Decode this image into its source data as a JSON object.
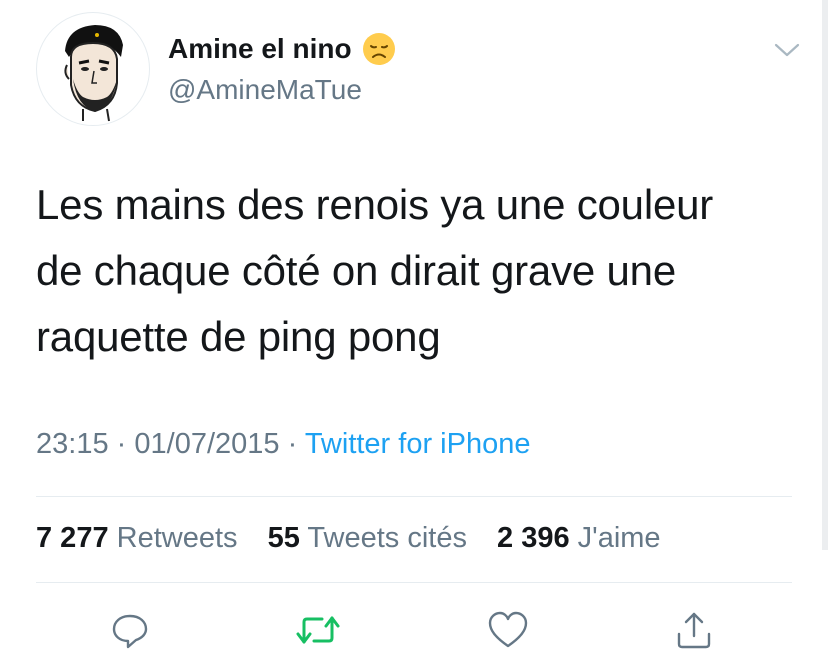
{
  "author": {
    "display_name": "Amine el nino",
    "handle": "@AmineMaTue",
    "emoji": "disappointed-face-emoji"
  },
  "tweet": {
    "lines": [
      "Les mains des renois ya une couleur",
      "de chaque côté on dirait grave une",
      "raquette de ping pong"
    ]
  },
  "meta": {
    "time": "23:15",
    "separator": "·",
    "date": "01/07/2015",
    "source": "Twitter for iPhone"
  },
  "stats": {
    "retweets_count": "7 277",
    "retweets_label": "Retweets",
    "quotes_count": "55",
    "quotes_label": "Tweets cités",
    "likes_count": "2 396",
    "likes_label": "J'aime"
  },
  "actions": [
    "reply-icon",
    "retweet-icon",
    "like-icon",
    "share-icon"
  ],
  "colors": {
    "accent": "#1da1f2",
    "retweet": "#17bf63",
    "muted": "#657786",
    "text": "#14171a",
    "divider": "#e6ecf0"
  }
}
